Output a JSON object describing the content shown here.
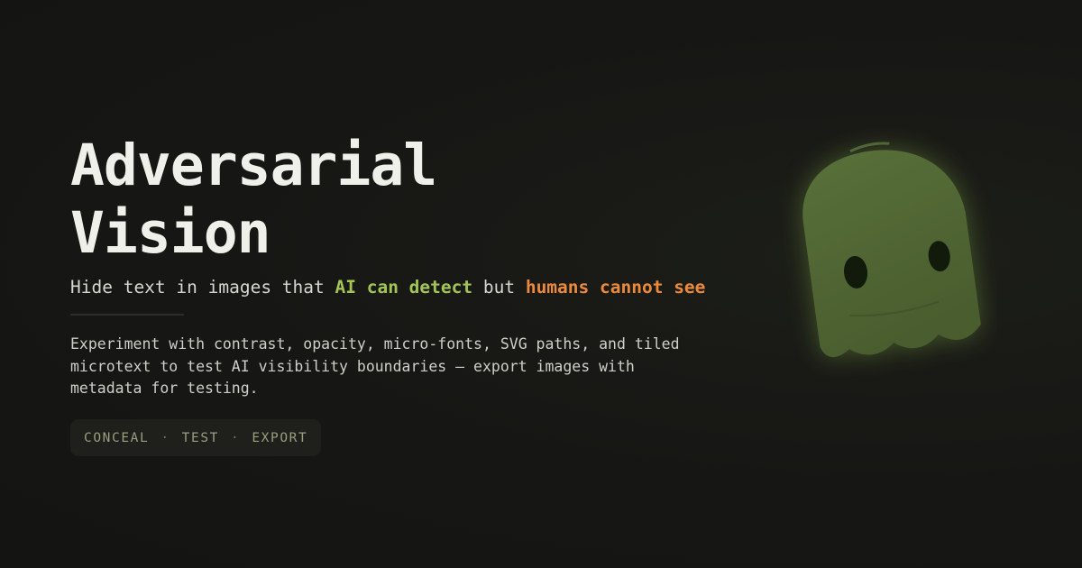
{
  "hero": {
    "title_line1": "Adversarial",
    "title_line2": "Vision",
    "tagline": {
      "prefix": "Hide text in images that ",
      "highlight_green": "AI can detect",
      "middle": " but ",
      "highlight_orange": "humans cannot see"
    },
    "description": "Experiment with contrast, opacity, micro-fonts, SVG paths, and tiled microtext to test AI visibility boundaries — export images with metadata for testing.",
    "pill": {
      "items": [
        "CONCEAL",
        "TEST",
        "EXPORT"
      ],
      "separator": "·"
    }
  },
  "illustration": {
    "icon": "ghost-icon",
    "body_color": "#4f6332",
    "glow_color": "#6b8a3a",
    "eye_color": "#121a0b"
  },
  "colors": {
    "background": "#161614",
    "accent_green": "#a4c456",
    "accent_orange": "#ec8a3c",
    "pill_text": "#9a9f7e"
  }
}
